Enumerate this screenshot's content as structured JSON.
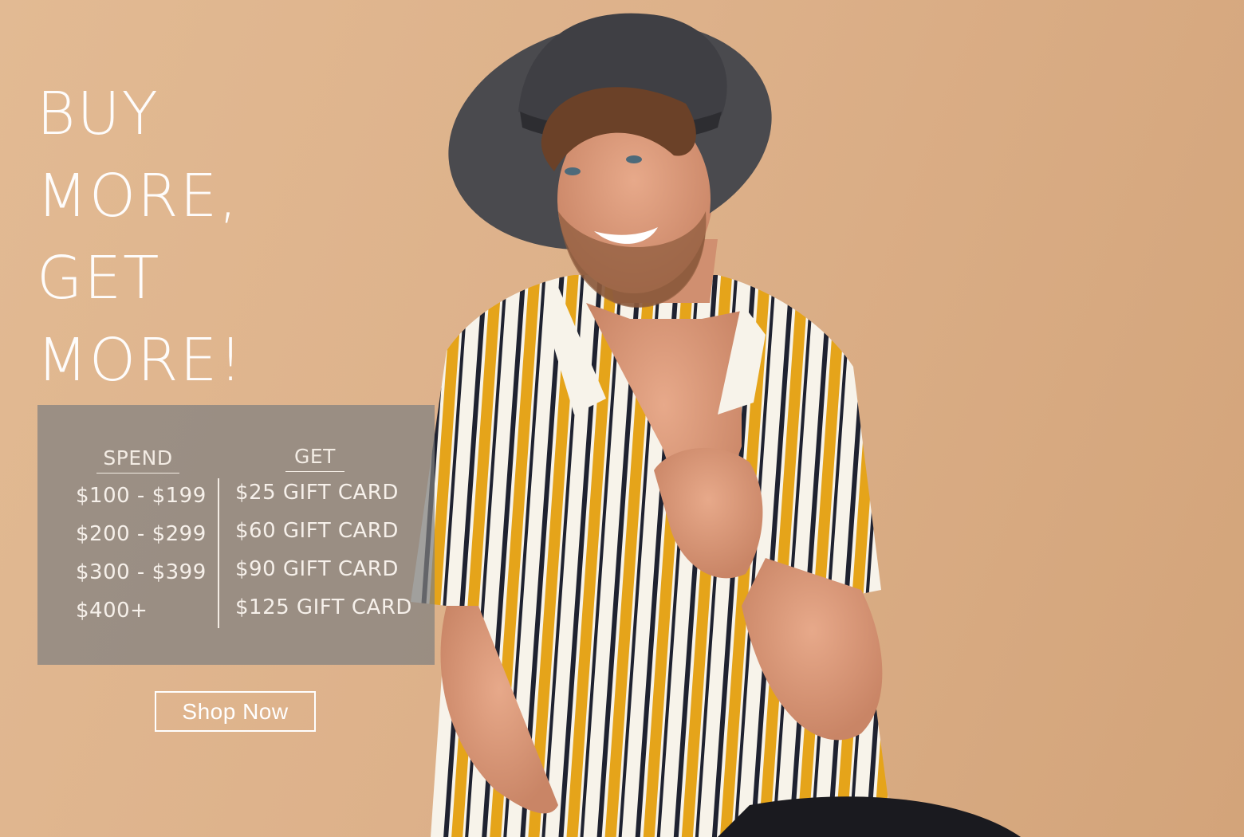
{
  "hero": {
    "headline_lines": [
      "BUY",
      "MORE,",
      "GET",
      "MORE!"
    ]
  },
  "offer": {
    "spend_heading": "SPEND",
    "get_heading": "GET",
    "spend_tiers": [
      "$100 - $199",
      "$200 - $299",
      "$300 - $399",
      "$400+"
    ],
    "get_rewards": [
      "$25 GIFT CARD",
      "$60 GIFT CARD",
      "$90 GIFT CARD",
      "$125 GIFT CARD"
    ]
  },
  "cta": {
    "label": "Shop Now"
  },
  "colors": {
    "background": "#dcb08a",
    "panel": "#808080",
    "text": "#ffffff",
    "shirt_yellow": "#e5a41a",
    "shirt_navy": "#1f2230",
    "hat": "#4a4a4e"
  }
}
